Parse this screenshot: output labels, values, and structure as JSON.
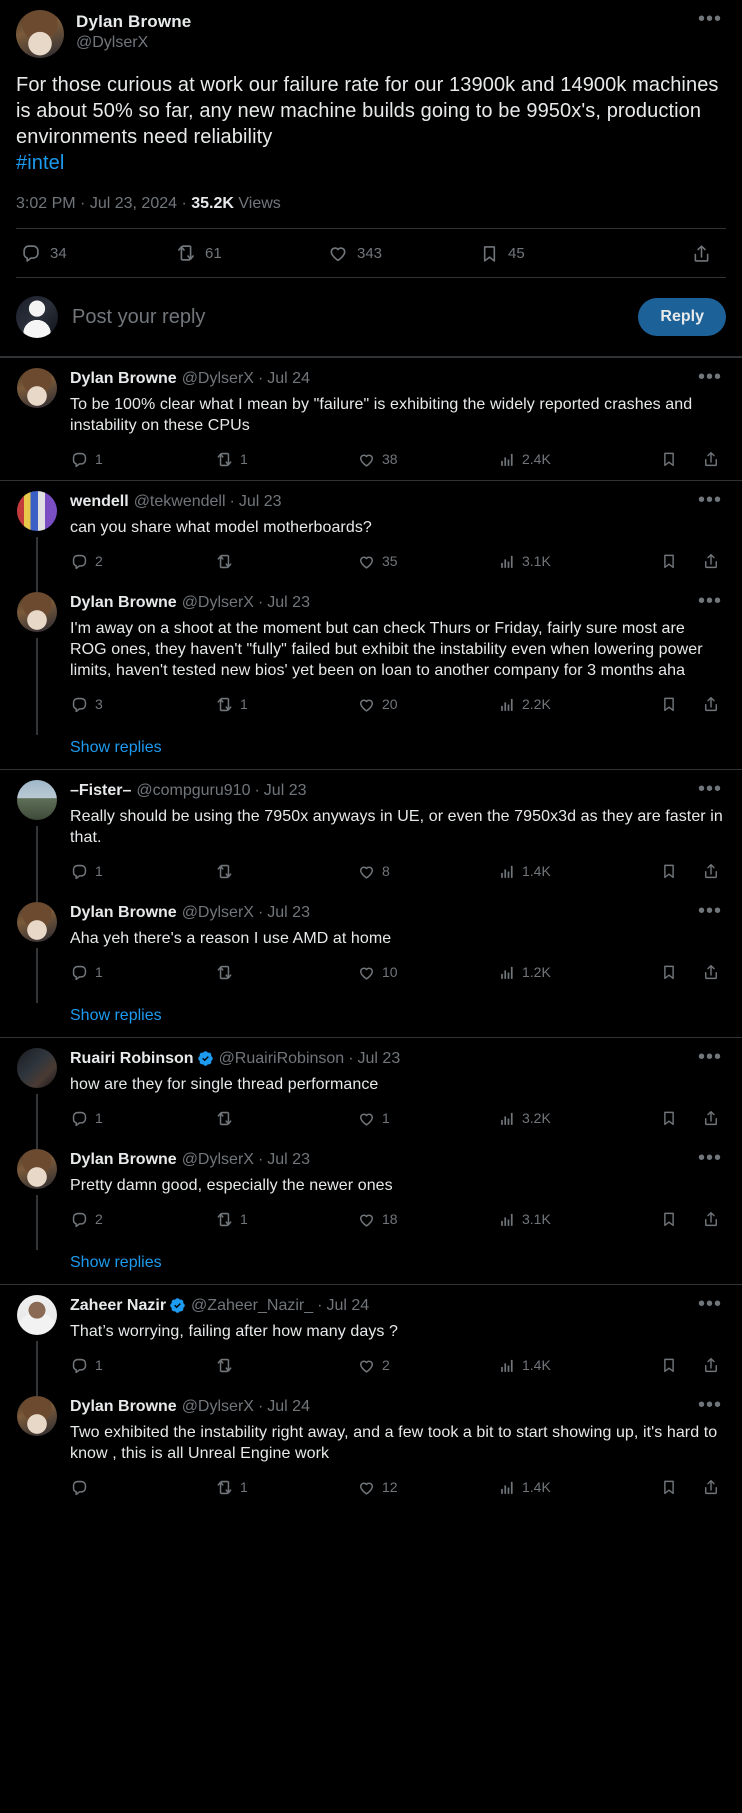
{
  "colors": {
    "background": "#000000",
    "text_primary": "#e7e9ea",
    "text_secondary": "#71767b",
    "accent_link": "#1d9bf0",
    "reply_button_bg": "#1d6199",
    "divider": "#2f3336",
    "thread_line": "#333639",
    "verified_badge": "#1d9bf0"
  },
  "main_tweet": {
    "display_name": "Dylan Browne",
    "handle": "@DylserX",
    "avatar_name": "dylan-browne-avatar",
    "more_icon": "more-options-icon",
    "body_text": "For those curious at work our failure rate for our 13900k and 14900k machines is about 50% so far, any new machine builds going to be 9950x's, production environments need reliability",
    "hashtag": "#intel",
    "timestamp": "3:02 PM",
    "date": "Jul 23, 2024",
    "views_count": "35.2K",
    "views_label": "Views",
    "separator": "·",
    "actions": {
      "reply": "34",
      "retweet": "61",
      "like": "343",
      "bookmark": "45",
      "share": ""
    }
  },
  "composer": {
    "avatar_name": "current-user-avatar",
    "placeholder": "Post your reply",
    "reply_button_label": "Reply"
  },
  "show_replies_label": "Show replies",
  "replies": [
    {
      "id": "reply-1",
      "display_name": "Dylan Browne",
      "handle": "@DylserX",
      "time": "Jul 24",
      "verified": false,
      "avatar_class": "ava-dylan",
      "avatar_name": "dylan-browne-avatar",
      "text": "To be 100% clear what I mean by \"failure\" is exhibiting the widely reported crashes and instability on these CPUs",
      "actions": {
        "reply": "1",
        "retweet": "1",
        "like": "38",
        "views": "2.4K"
      },
      "thread_line": false,
      "divider_above": true,
      "show_replies": false
    },
    {
      "id": "reply-2",
      "display_name": "wendell",
      "handle": "@tekwendell",
      "time": "Jul 23",
      "verified": false,
      "avatar_class": "ava-wendell",
      "avatar_name": "wendell-avatar",
      "text": "can you share what model motherboards?",
      "actions": {
        "reply": "2",
        "retweet": "",
        "like": "35",
        "views": "3.1K"
      },
      "thread_line": true,
      "divider_above": true,
      "show_replies": false
    },
    {
      "id": "reply-3",
      "display_name": "Dylan Browne",
      "handle": "@DylserX",
      "time": "Jul 23",
      "verified": false,
      "avatar_class": "ava-dylan",
      "avatar_name": "dylan-browne-avatar",
      "text": "I'm away on a shoot at the moment but can check Thurs or Friday, fairly sure most are ROG ones, they haven't \"fully\" failed but exhibit the instability even when lowering power limits, haven't tested new bios' yet been on loan to another company for 3 months aha",
      "actions": {
        "reply": "3",
        "retweet": "1",
        "like": "20",
        "views": "2.2K"
      },
      "thread_line": true,
      "divider_above": false,
      "show_replies": true
    },
    {
      "id": "reply-4",
      "display_name": "–Fister–",
      "handle": "@compguru910",
      "time": "Jul 23",
      "verified": false,
      "avatar_class": "ava-fister",
      "avatar_name": "fister-avatar",
      "text": "Really should be using the 7950x anyways in UE, or even the 7950x3d as they are faster in that.",
      "actions": {
        "reply": "1",
        "retweet": "",
        "like": "8",
        "views": "1.4K"
      },
      "thread_line": true,
      "divider_above": true,
      "show_replies": false
    },
    {
      "id": "reply-5",
      "display_name": "Dylan Browne",
      "handle": "@DylserX",
      "time": "Jul 23",
      "verified": false,
      "avatar_class": "ava-dylan",
      "avatar_name": "dylan-browne-avatar",
      "text": "Aha yeh there's a reason I use AMD at home",
      "actions": {
        "reply": "1",
        "retweet": "",
        "like": "10",
        "views": "1.2K"
      },
      "thread_line": true,
      "divider_above": false,
      "show_replies": true
    },
    {
      "id": "reply-6",
      "display_name": "Ruairi Robinson",
      "handle": "@RuairiRobinson",
      "time": "Jul 23",
      "verified": true,
      "avatar_class": "ava-ruairi",
      "avatar_name": "ruairi-robinson-avatar",
      "text": "how are they for single thread performance",
      "actions": {
        "reply": "1",
        "retweet": "",
        "like": "1",
        "views": "3.2K"
      },
      "thread_line": true,
      "divider_above": true,
      "show_replies": false
    },
    {
      "id": "reply-7",
      "display_name": "Dylan Browne",
      "handle": "@DylserX",
      "time": "Jul 23",
      "verified": false,
      "avatar_class": "ava-dylan",
      "avatar_name": "dylan-browne-avatar",
      "text": "Pretty damn good, especially the newer ones",
      "actions": {
        "reply": "2",
        "retweet": "1",
        "like": "18",
        "views": "3.1K"
      },
      "thread_line": true,
      "divider_above": false,
      "show_replies": true
    },
    {
      "id": "reply-8",
      "display_name": "Zaheer Nazir",
      "handle": "@Zaheer_Nazir_",
      "time": "Jul 24",
      "verified": true,
      "avatar_class": "ava-zaheer",
      "avatar_name": "zaheer-nazir-avatar",
      "text": "That’s worrying, failing after how many days ?",
      "actions": {
        "reply": "1",
        "retweet": "",
        "like": "2",
        "views": "1.4K"
      },
      "thread_line": true,
      "divider_above": true,
      "show_replies": false
    },
    {
      "id": "reply-9",
      "display_name": "Dylan Browne",
      "handle": "@DylserX",
      "time": "Jul 24",
      "verified": false,
      "avatar_class": "ava-dylan",
      "avatar_name": "dylan-browne-avatar",
      "text": "Two exhibited the instability right away, and a few took a bit to start showing up, it's hard to know , this is all Unreal Engine work",
      "actions": {
        "reply": "",
        "retweet": "1",
        "like": "12",
        "views": "1.4K"
      },
      "thread_line": false,
      "divider_above": false,
      "show_replies": false
    }
  ],
  "icons": {
    "reply": "reply-icon",
    "retweet": "retweet-icon",
    "like": "heart-icon",
    "views": "views-chart-icon",
    "bookmark": "bookmark-icon",
    "share": "share-icon",
    "more": "more-options-icon",
    "verified": "verified-badge-icon"
  }
}
